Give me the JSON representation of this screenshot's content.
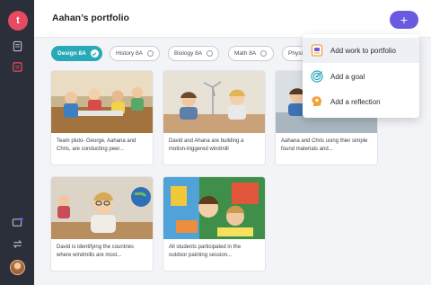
{
  "sidebar": {
    "logo_letter": "t"
  },
  "header": {
    "title": "Aahan’s portfolio",
    "add_label": "+"
  },
  "filters": [
    {
      "label": "Design 8A",
      "active": true
    },
    {
      "label": "History 8A",
      "active": false
    },
    {
      "label": "Biology 8A",
      "active": false
    },
    {
      "label": "Math 8A",
      "active": false
    },
    {
      "label": "Physi",
      "active": false
    }
  ],
  "cards": [
    {
      "caption": "Team pluto- George, Aahana and Chris, are conducting peer..."
    },
    {
      "caption": "David and Ahana are building a motion-triggered windmill"
    },
    {
      "caption": "Aahana and Chris using thier simple found materials and..."
    },
    {
      "caption": "David is identifying the countries where windmills are most..."
    },
    {
      "caption": "All students participated in the outdoor painting session..."
    }
  ],
  "menu": {
    "items": [
      {
        "label": "Add work to portfolio",
        "icon": "portfolio-icon"
      },
      {
        "label": "Add a goal",
        "icon": "target-icon"
      },
      {
        "label": "Add a reflection",
        "icon": "reflection-icon"
      }
    ]
  },
  "colors": {
    "accent": "#6a5ae0",
    "active_pill": "#28a9b8",
    "sidebar": "#2b2f3a",
    "logo": "#e84a5f"
  }
}
